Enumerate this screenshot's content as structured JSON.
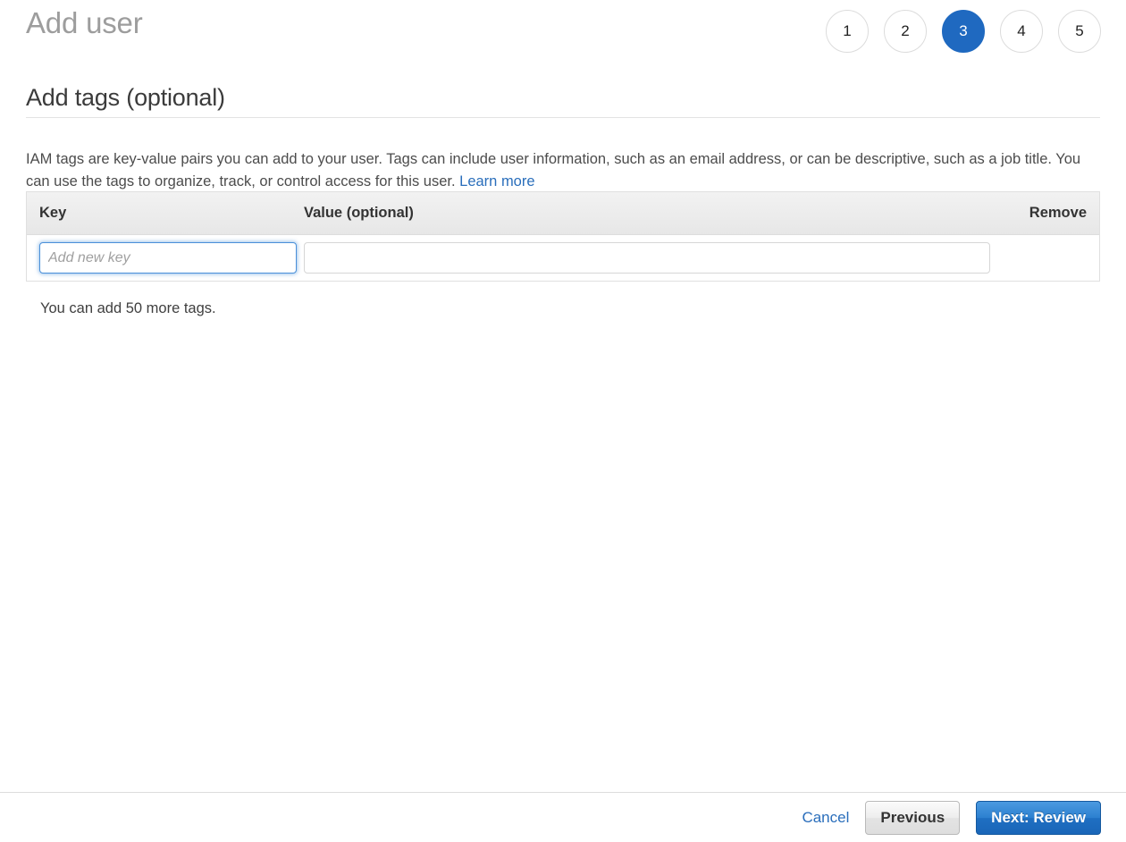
{
  "header": {
    "title": "Add user",
    "steps": [
      {
        "label": "1",
        "active": false
      },
      {
        "label": "2",
        "active": false
      },
      {
        "label": "3",
        "active": true
      },
      {
        "label": "4",
        "active": false
      },
      {
        "label": "5",
        "active": false
      }
    ]
  },
  "section": {
    "title": "Add tags (optional)",
    "description_part1": "IAM tags are key-value pairs you can add to your user. Tags can include user information, such as an email address, or can be descriptive, such as a job title. You can use the tags to organize, track, or control access for this user. ",
    "learn_more": "Learn more"
  },
  "tags_table": {
    "columns": {
      "key": "Key",
      "value": "Value (optional)",
      "remove": "Remove"
    },
    "rows": [
      {
        "key_value": "",
        "key_placeholder": "Add new key",
        "value_value": "",
        "value_placeholder": ""
      }
    ],
    "note": "You can add 50 more tags."
  },
  "footer": {
    "cancel": "Cancel",
    "previous": "Previous",
    "next": "Next: Review"
  },
  "colors": {
    "accent_blue": "#1f69c0",
    "link_blue": "#2a6ebb",
    "focus_blue": "#4a90d9",
    "title_gray": "#9d9d9d"
  }
}
